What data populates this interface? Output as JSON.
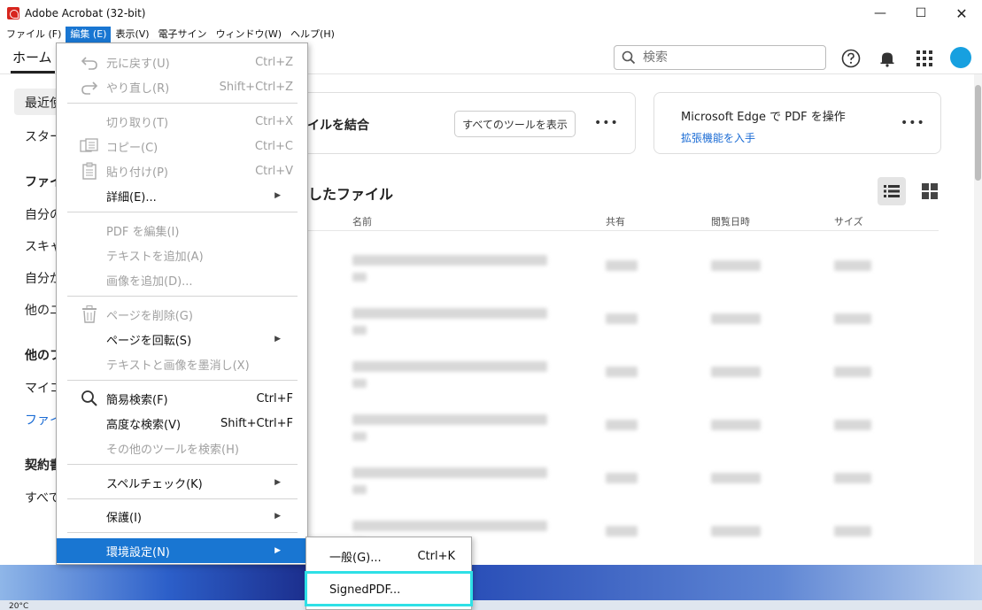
{
  "window": {
    "title": "Adobe Acrobat (32-bit)",
    "minimize_glyph": "—",
    "maximize_glyph": "☐",
    "close_glyph": "✕"
  },
  "menubar": {
    "items": [
      "ファイル (F)",
      "編集 (E)",
      "表示(V)",
      "電子サイン",
      "ウィンドウ(W)",
      "ヘルプ(H)"
    ],
    "active_index": 1
  },
  "toolbar": {
    "home_tab": "ホーム",
    "search_placeholder": "検索"
  },
  "leftnav": {
    "items": [
      {
        "label": "最近使",
        "style": "normal"
      },
      {
        "label": "スター",
        "style": "normal"
      },
      {
        "label": "ファイル",
        "style": "bold"
      },
      {
        "label": "自分の",
        "style": "normal"
      },
      {
        "label": "スキャ",
        "style": "normal"
      },
      {
        "label": "自分が",
        "style": "normal"
      },
      {
        "label": "他のユ",
        "style": "normal"
      },
      {
        "label": "他のフ",
        "style": "bold"
      },
      {
        "label": "マイコ",
        "style": "normal"
      },
      {
        "label": "ファイル",
        "style": "link"
      },
      {
        "label": "契約書",
        "style": "bold"
      },
      {
        "label": "すべて",
        "style": "normal"
      }
    ]
  },
  "cards": {
    "card1_title": "イルを結合",
    "all_tools_button": "すべてのツールを表示",
    "more": "•••",
    "card2_title": "Microsoft Edge で PDF を操作",
    "card2_link": "拡張機能を入手"
  },
  "files": {
    "section_title": "したファイル",
    "columns": {
      "name": "名前",
      "shared": "共有",
      "opened": "閲覧日時",
      "size": "サイズ"
    }
  },
  "edit_menu": {
    "items": [
      {
        "label": "元に戻す(U)",
        "shortcut": "Ctrl+Z",
        "enabled": false,
        "icon": "undo-icon"
      },
      {
        "label": "やり直し(R)",
        "shortcut": "Shift+Ctrl+Z",
        "enabled": false,
        "icon": "redo-icon"
      },
      {
        "label": "切り取り(T)",
        "shortcut": "Ctrl+X",
        "enabled": false,
        "icon": ""
      },
      {
        "label": "コピー(C)",
        "shortcut": "Ctrl+C",
        "enabled": false,
        "icon": "copy-icon"
      },
      {
        "label": "貼り付け(P)",
        "shortcut": "Ctrl+V",
        "enabled": false,
        "icon": "paste-icon"
      },
      {
        "label": "詳細(E)...",
        "shortcut": "",
        "enabled": true,
        "submenu": true
      },
      {
        "label": "PDF を編集(I)",
        "shortcut": "",
        "enabled": false
      },
      {
        "label": "テキストを追加(A)",
        "shortcut": "",
        "enabled": false
      },
      {
        "label": "画像を追加(D)...",
        "shortcut": "",
        "enabled": false
      },
      {
        "label": "ページを削除(G)",
        "shortcut": "",
        "enabled": false,
        "icon": "trash-icon"
      },
      {
        "label": "ページを回転(S)",
        "shortcut": "",
        "enabled": true,
        "submenu": true
      },
      {
        "label": "テキストと画像を墨消し(X)",
        "shortcut": "",
        "enabled": false
      },
      {
        "label": "簡易検索(F)",
        "shortcut": "Ctrl+F",
        "enabled": true,
        "icon": "search-icon"
      },
      {
        "label": "高度な検索(V)",
        "shortcut": "Shift+Ctrl+F",
        "enabled": true
      },
      {
        "label": "その他のツールを検索(H)",
        "shortcut": "",
        "enabled": false
      },
      {
        "label": "スペルチェック(K)",
        "shortcut": "",
        "enabled": true,
        "submenu": true
      },
      {
        "label": "保護(I)",
        "shortcut": "",
        "enabled": true,
        "submenu": true
      },
      {
        "label": "環境設定(N)",
        "shortcut": "",
        "enabled": true,
        "submenu": true,
        "highlighted": true
      }
    ],
    "submenu_arrow": "▶"
  },
  "preferences_submenu": {
    "items": [
      {
        "label": "一般(G)...",
        "shortcut": "Ctrl+K"
      },
      {
        "label": "SignedPDF...",
        "shortcut": ""
      }
    ],
    "highlight_color": "#2ee0e6"
  },
  "taskbar": {
    "weather": "20°C"
  },
  "colors": {
    "accent": "#1976d2",
    "link": "#1a6bd4",
    "acrobat_red": "#d7261e",
    "avatar": "#17a0e0"
  }
}
